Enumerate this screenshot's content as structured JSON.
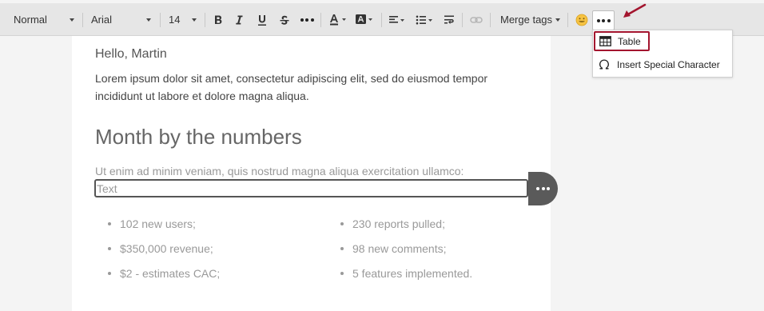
{
  "toolbar": {
    "style_select": "Normal",
    "font_select": "Arial",
    "size_select": "14",
    "merge_tags_label": "Merge tags"
  },
  "more_menu": {
    "items": [
      {
        "label": "Table",
        "icon": "table-icon"
      },
      {
        "label": "Insert Special Character",
        "icon": "omega-icon"
      }
    ]
  },
  "document": {
    "greeting": "Hello, Martin",
    "intro": "Lorem ipsum dolor sit amet, consectetur adipiscing elit, sed do eiusmod tempor incididunt ut labore et dolore magna aliqua.",
    "heading": "Month by the numbers",
    "subtext": "Ut enim ad minim veniam, quis nostrud magna aliqua exercitation ullamco:",
    "text_block_placeholder": "Text",
    "list_left": [
      "102 new users;",
      "$350,000 revenue;",
      "$2 - estimates CAC;"
    ],
    "list_right": [
      "230 reports pulled;",
      "98 new comments;",
      "5 features implemented."
    ]
  },
  "colors": {
    "highlight": "#a3152e",
    "toolbar_bg": "#e6e6e6",
    "fab_bg": "#5a5a5a"
  }
}
